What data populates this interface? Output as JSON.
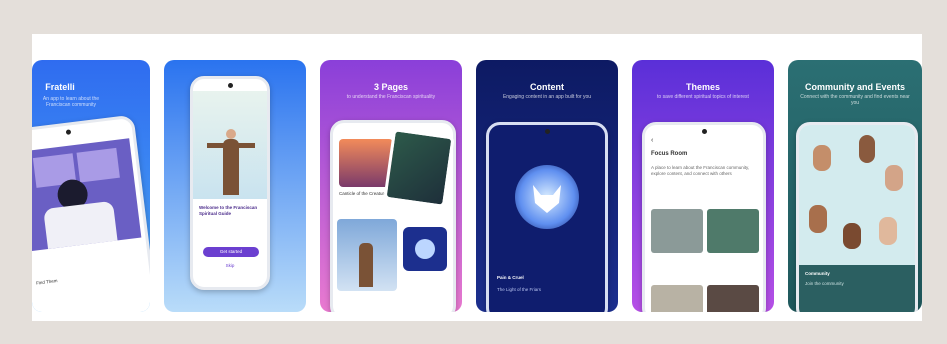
{
  "cards": [
    {
      "title": "Fratelli",
      "subtitle": "An app to learn about the Franciscan community",
      "colors": {
        "top": "#2f6cf0",
        "bottom": "#4aa8f5"
      },
      "phone_caption": "Find Them"
    },
    {
      "title": "",
      "subtitle": "",
      "colors": {
        "top": "#2a73ef",
        "bottom": "#b9dcf9"
      },
      "phone_text": "Welcome to the Franciscan Spiritual Guide",
      "button_label": "Get started",
      "link_label": "Skip"
    },
    {
      "title": "3 Pages",
      "subtitle": "to understand the Franciscan spirituality",
      "colors": {
        "top": "#8a3fd9",
        "bottom": "#e97ad0"
      },
      "phone_caption": "Canticle of the Creatures"
    },
    {
      "title": "Content",
      "subtitle": "Engaging content in an app built for you",
      "colors": {
        "top": "#0d1a63",
        "bottom": "#1c2f8e"
      },
      "phone_caption": "Pain & Cruel",
      "phone_body": "The Light of the Friars",
      "icon": "wolf-icon"
    },
    {
      "title": "Themes",
      "subtitle": "to save different spiritual topics of interest",
      "colors": {
        "top": "#5a2fd8",
        "bottom": "#b650e6"
      },
      "phone_title": "Focus Room",
      "phone_body": "A place to learn about the Franciscan community, explore content, and connect with others"
    },
    {
      "title": "Community and Events",
      "subtitle": "Connect with the community and find events near you",
      "colors": {
        "top": "#2b6f73",
        "bottom": "#1f585c"
      },
      "phone_caption": "Community",
      "phone_body": "Join the community"
    }
  ]
}
